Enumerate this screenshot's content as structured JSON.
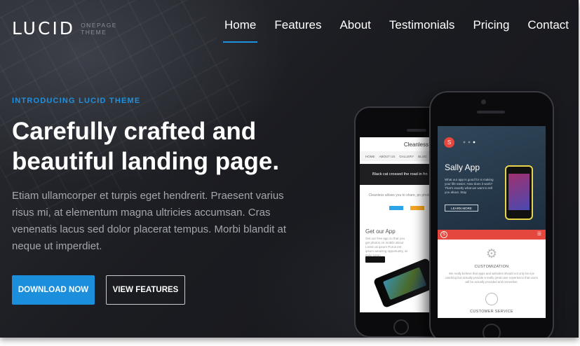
{
  "brand": {
    "name": "LUCID",
    "sub_line1": "ONEPAGE",
    "sub_line2": "THEME"
  },
  "nav": {
    "items": [
      {
        "label": "Home",
        "active": true
      },
      {
        "label": "Features",
        "active": false
      },
      {
        "label": "About",
        "active": false
      },
      {
        "label": "Testimonials",
        "active": false
      },
      {
        "label": "Pricing",
        "active": false
      },
      {
        "label": "Contact",
        "active": false
      }
    ]
  },
  "hero": {
    "eyebrow": "INTRODUCING LUCID THEME",
    "headline": "Carefully crafted and beautiful landing page.",
    "lede": "Etiam ullamcorper et turpis eget hendrerit. Praesent varius risus mi, at elementum magna ultricies accumsan. Cras venenatis lacus sed dolor placerat tempus. Morbi blandit at neque ut imperdiet.",
    "primary_button": "DOWNLOAD NOW",
    "secondary_button": "VIEW FEATURES"
  },
  "mockups": {
    "back_screen": {
      "brand": "Cleanless",
      "nav": [
        "HOME",
        "ABOUT US",
        "GALLERY",
        "BLOG"
      ],
      "banner": "Black cat crossed the road in fro",
      "text": "Cleanless allows you to share, po photos",
      "subheading": "Get our App",
      "subtext": "Get our free app so that you get photos on mobile about Lorem at ipsum Purus est ipsum amazing opportunity, at pulvi lorem"
    },
    "front_screen": {
      "badge": "S",
      "title": "Sally App",
      "desc": "What our app is good for is making your life easier. How does it work? That's exactly what we want to tell you about. Stay",
      "button": "LEARN MORE",
      "bar_badge": "S",
      "menu": "☰",
      "caption1": "CUSTOMIZATION",
      "paragraph": "We really believe that apps and websites should not only be eye catching but actually provide a really great user experience that users will be actually provided and remember.",
      "caption2": "CUSTOMER SERVICE"
    }
  },
  "colors": {
    "accent": "#1e90e0",
    "button_primary": "#1b8fdc",
    "mockup_red": "#e4473d"
  },
  "icons": {
    "gear": "gear-icon",
    "clock": "clock-icon",
    "menu": "menu-icon"
  }
}
